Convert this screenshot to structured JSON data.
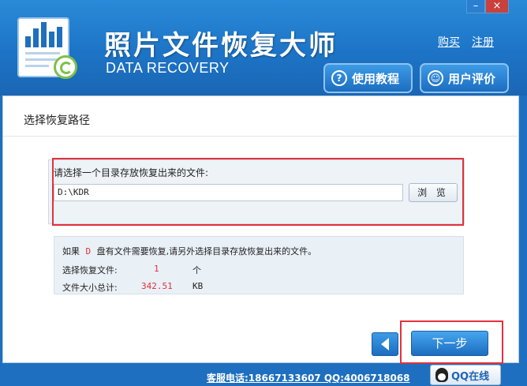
{
  "app": {
    "title": "照片文件恢复大师",
    "subtitle": "DATA RECOVERY"
  },
  "header": {
    "buy_link": "购买",
    "register_link": "注册",
    "tutorial_button": "使用教程",
    "review_button": "用户评价",
    "tutorial_icon_glyph": "?",
    "review_icon_glyph": "☺"
  },
  "window_controls": {
    "minimize": "–",
    "close": "×"
  },
  "main": {
    "section_title": "选择恢复路径",
    "path_label": "请选择一个目录存放恢复出来的文件:",
    "path_value": "D:\\KDR",
    "browse_button": "浏 览",
    "info": {
      "line1_prefix": "如果",
      "drive": "D",
      "line1_suffix": "盘有文件需要恢复,请另外选择目录存放恢复出来的文件。",
      "files_label": "选择恢复文件:",
      "files_count": "1",
      "files_unit": "个",
      "size_label": "文件大小总计:",
      "size_value": "342.51",
      "size_unit": "KB"
    },
    "next_button": "下一步"
  },
  "footer": {
    "contact": "客服电话:18667133607 QQ:4006718068",
    "qq_online": "QQ在线"
  },
  "colors": {
    "brand_blue": "#1e6fbf",
    "highlight_red": "#e3313b",
    "value_red": "#e3313b"
  }
}
